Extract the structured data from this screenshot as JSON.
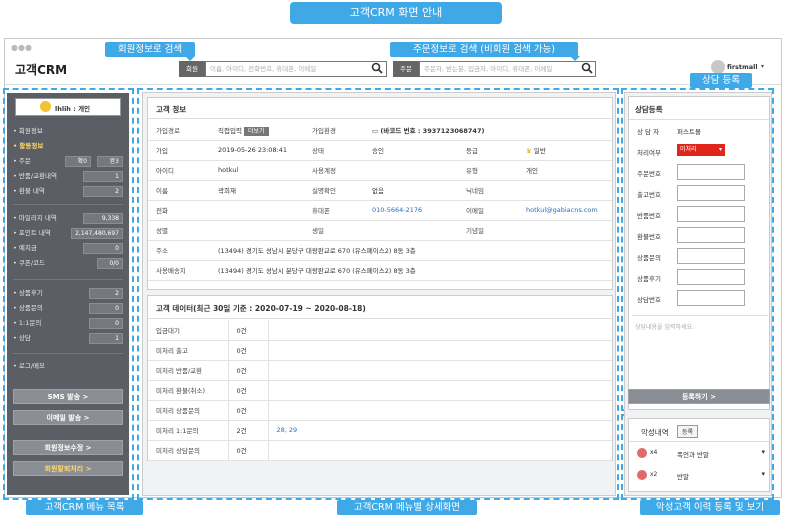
{
  "banner": "고객CRM 화면 안내",
  "callouts": {
    "member_search": "회원정보로 검색",
    "order_search": "주문정보로 검색 (비회원 검색 가능)",
    "consult_reg": "상담 등록",
    "left_menu": "고객CRM 메뉴 목록",
    "detail": "고객CRM 메뉴별 상세화면",
    "bad_customer": "악성고객 이력 등록 및 보기"
  },
  "header": {
    "logo": "고객CRM",
    "member_label": "회원",
    "member_placeholder": "이름, 아이디, 전화번호, 휴대폰, 이메일",
    "order_label": "주문",
    "order_placeholder": "주문자, 받는분, 입금자, 아이디, 휴대폰, 이메일",
    "user": "firstmall"
  },
  "left": {
    "profile": "lhlih : 개인",
    "items": [
      {
        "label": "회원정보"
      },
      {
        "label": "활동정보"
      }
    ],
    "order": {
      "label": "주문",
      "a": "확0",
      "b": "완3"
    },
    "rows1": [
      {
        "label": "반품/교환내역",
        "value": "1"
      },
      {
        "label": "환불 내역",
        "value": "2"
      }
    ],
    "rows2": [
      {
        "label": "마일리지 내역",
        "value": "9,338"
      },
      {
        "label": "포인트 내역",
        "value": "2,147,480,697"
      },
      {
        "label": "예치금",
        "value": "0"
      },
      {
        "label": "쿠폰/코드",
        "value": "0/0"
      }
    ],
    "rows3": [
      {
        "label": "상품후기",
        "value": "2"
      },
      {
        "label": "상품문의",
        "value": "0"
      },
      {
        "label": "1:1문의",
        "value": "0"
      },
      {
        "label": "상담",
        "value": "1"
      }
    ],
    "log": "로그/메모",
    "btn_sms": "SMS 발송 >",
    "btn_email": "이메일 발송 >",
    "btn_edit": "회원정보수정 >",
    "btn_withdraw": "회원탈퇴처리 >"
  },
  "info": {
    "title": "고객 정보",
    "more": "더보기",
    "barcode": "(바코드 번호 : 3937123068747)",
    "r1": [
      "가입경로",
      "직접입력",
      "가입환경",
      ""
    ],
    "r2": [
      "가입",
      "2019-05-26 23:08:41",
      "상태",
      "승인",
      "등급",
      "일반"
    ],
    "r3": [
      "아이디",
      "hotkul",
      "사용계정",
      "",
      "유형",
      "개인"
    ],
    "r4": [
      "이름",
      "곽희재",
      "실명확인",
      "없음",
      "닉네임",
      ""
    ],
    "r5": [
      "전화",
      "",
      "휴대폰",
      "010-5664-2176",
      "이메일",
      "hotkul@gabiacns.com"
    ],
    "r6": [
      "성별",
      "",
      "생일",
      "",
      "기념일",
      ""
    ],
    "r7": [
      "주소",
      "(13494) 경기도 성남시 분당구 대왕판교로 670 (유스페이스2) 8동 3층"
    ],
    "r8": [
      "사용배송지",
      "(13494) 경기도 성남시 분당구 대왕판교로 670 (유스페이스2) 8동 3층"
    ]
  },
  "data_panel": {
    "title": "고객 데이터(최근 30일 기준 : 2020-07-19 ~ 2020-08-18)",
    "rows": [
      {
        "label": "입금대기",
        "count": "0건",
        "extra": ""
      },
      {
        "label": "미처리 출고",
        "count": "0건",
        "extra": ""
      },
      {
        "label": "미처리 반품/교환",
        "count": "0건",
        "extra": ""
      },
      {
        "label": "미처리 환불(취소)",
        "count": "0건",
        "extra": ""
      },
      {
        "label": "미처리 상품문의",
        "count": "0건",
        "extra": ""
      },
      {
        "label": "미처리 1:1문의",
        "count": "2건",
        "extra": "28, 29"
      },
      {
        "label": "미처리 상담문의",
        "count": "0건",
        "extra": ""
      }
    ]
  },
  "consult": {
    "title": "상담등록",
    "counselor_label": "상 담 자",
    "counselor": "퍼스트몰",
    "status_label": "처리여부",
    "status": "미처리",
    "fields": [
      "주문번호",
      "출고번호",
      "반품번호",
      "환불번호",
      "상품문의",
      "상품후기",
      "상담번호"
    ],
    "placeholder": "상담내용을 입력하세요.",
    "submit": "등록하기 >"
  },
  "bad": {
    "title": "악성내역",
    "reg": "등록",
    "rows": [
      {
        "count": "x4",
        "label": "폭언과 반말"
      },
      {
        "count": "x2",
        "label": "반말"
      }
    ]
  }
}
